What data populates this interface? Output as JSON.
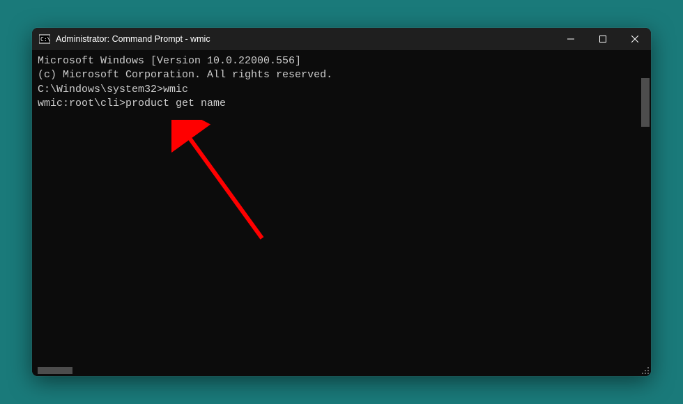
{
  "window": {
    "title": "Administrator: Command Prompt - wmic"
  },
  "terminal": {
    "line1": "Microsoft Windows [Version 10.0.22000.556]",
    "line2": "(c) Microsoft Corporation. All rights reserved.",
    "blank1": "",
    "prompt1": "C:\\Windows\\system32>wmic",
    "prompt2": "wmic:root\\cli>product get name"
  },
  "annotation": {
    "type": "arrow",
    "color": "#ff0000",
    "points_to": "product get name command"
  }
}
